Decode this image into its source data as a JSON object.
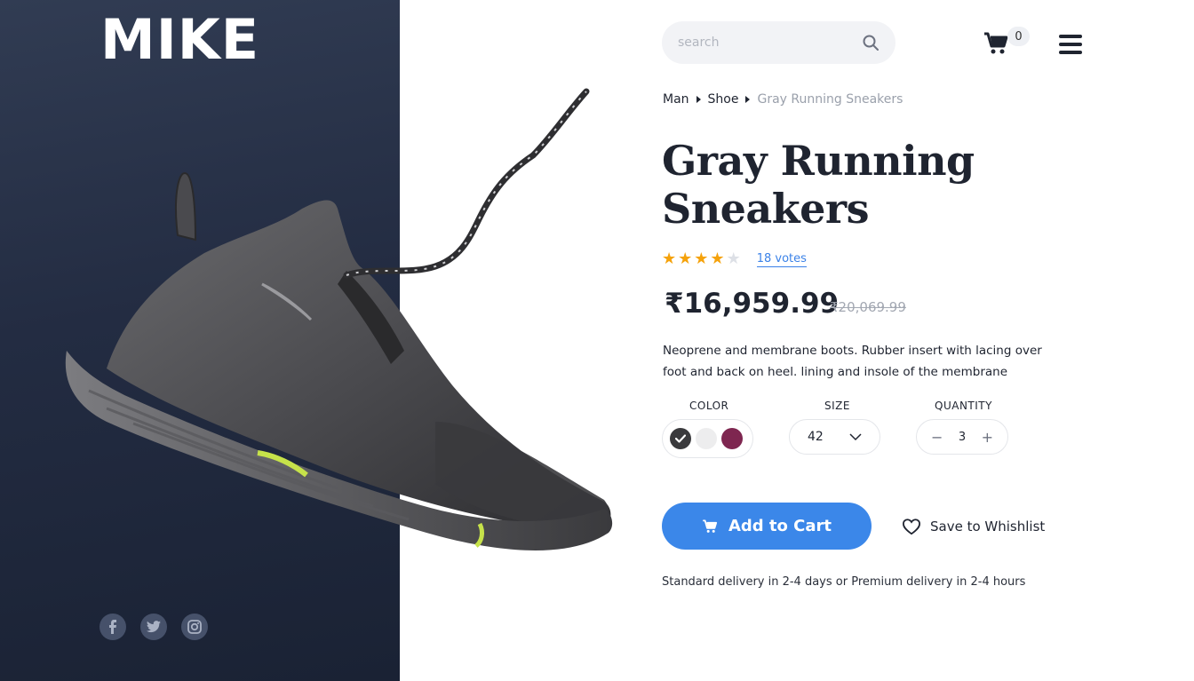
{
  "brand": {
    "logo_text": "MIKE"
  },
  "header": {
    "search": {
      "placeholder": "search",
      "value": "",
      "icon": "search-icon"
    },
    "cart": {
      "icon": "cart-icon",
      "count": "0"
    },
    "menu": {
      "icon": "hamburger-menu-icon"
    }
  },
  "breadcrumb": [
    {
      "label": "Man"
    },
    {
      "label": "Shoe"
    },
    {
      "label": "Gray Running Sneakers"
    }
  ],
  "product": {
    "title": "Gray Running Sneakers",
    "rating": {
      "stars_filled": 4,
      "stars_total": 5,
      "votes_label": "18 votes"
    },
    "price": "₹16,959.99",
    "old_price": "₹20,069.99",
    "description": "Neoprene and membrane boots. Rubber insert with lacing over foot and back on heel. lining and insole of the membrane",
    "options": {
      "color_label": "COLOR",
      "colors": [
        "#3a3a3d",
        "#ededee",
        "#7e2650"
      ],
      "selected_color_index": 0,
      "size_label": "SIZE",
      "size_value": "42",
      "quantity_label": "QUANTITY",
      "quantity_value": "3",
      "decrement_symbol": "−",
      "increment_symbol": "+"
    },
    "add_to_cart_label": "Add to Cart",
    "wishlist_label": "Save to Whishlist",
    "delivery_note": "Standard delivery in 2-4 days or Premium delivery in 2-4 hours"
  },
  "social": [
    {
      "icon": "facebook-icon"
    },
    {
      "icon": "twitter-icon"
    },
    {
      "icon": "instagram-icon"
    }
  ],
  "colors": {
    "accent": "#3b87e9",
    "star": "#f5a20b",
    "dark_panel": "#232c42"
  }
}
